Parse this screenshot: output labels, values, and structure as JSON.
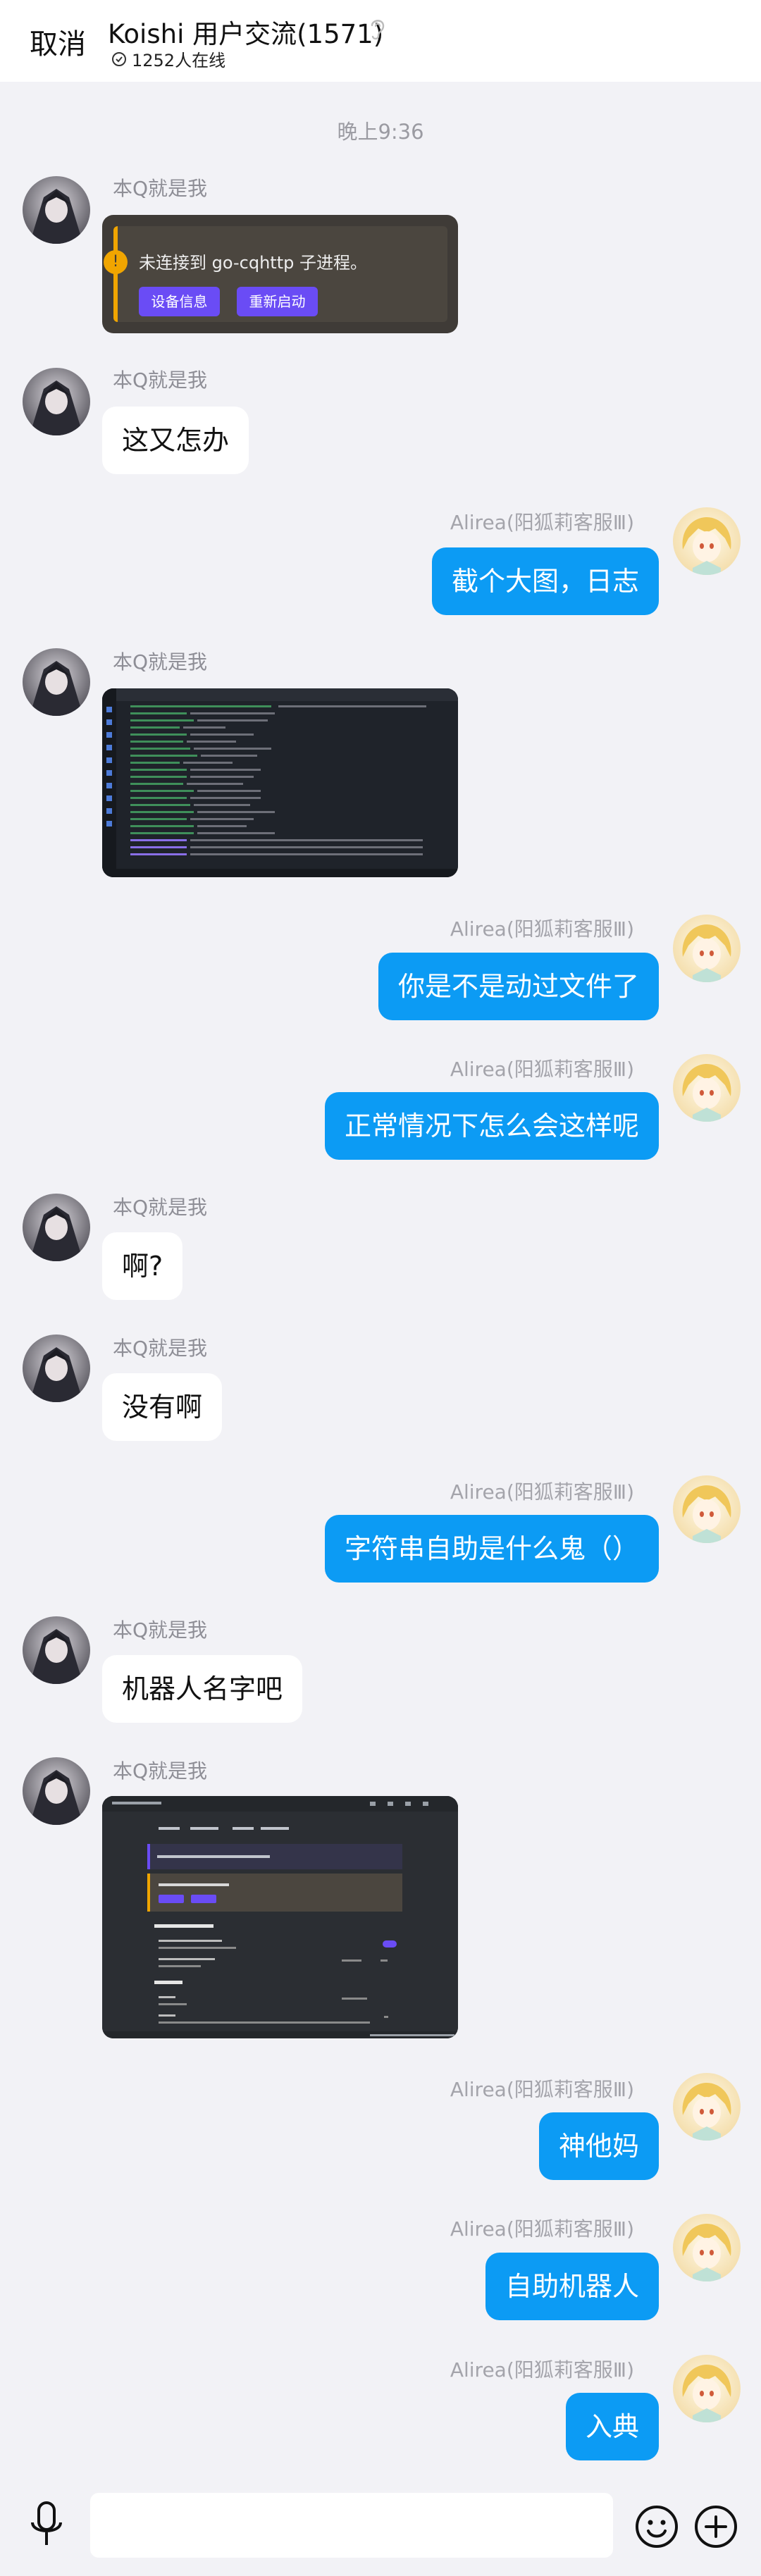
{
  "header": {
    "cancel_label": "取消",
    "title": "Koishi 用户交流(1571)",
    "online_text": "1252人在线"
  },
  "time_separator": "晚上9:36",
  "sender_left": "本Q就是我",
  "sender_right": "Alirea(阳狐莉客服Ⅲ)",
  "messages": {
    "m1": {
      "side": "left",
      "type": "image",
      "alert_text": "未连接到 go-cqhttp 子进程。",
      "btn1": "设备信息",
      "btn2": "重新启动"
    },
    "m2": {
      "side": "left",
      "text": "这又怎办"
    },
    "m3": {
      "side": "right",
      "text": "截个大图，日志"
    },
    "m4": {
      "side": "left",
      "type": "image",
      "description_icon": "terminal-log-screenshot"
    },
    "m5": {
      "side": "right",
      "text": "你是不是动过文件了"
    },
    "m6": {
      "side": "right",
      "text": "正常情况下怎么会这样呢"
    },
    "m7": {
      "side": "left",
      "text": "啊?"
    },
    "m8": {
      "side": "left",
      "text": "没有啊"
    },
    "m9": {
      "side": "right",
      "text": "字符串自助是什么鬼（）"
    },
    "m10": {
      "side": "left",
      "text": "机器人名字吧"
    },
    "m11": {
      "side": "left",
      "type": "image",
      "description_icon": "settings-screenshot"
    },
    "m12": {
      "side": "right",
      "text": "神他妈"
    },
    "m13": {
      "side": "right",
      "text": "自助机器人"
    },
    "m14": {
      "side": "right",
      "text": "入典"
    }
  },
  "colors": {
    "bubble_right": "#0c9bf4",
    "bubble_left": "#ffffff",
    "background": "#f2f2f6"
  },
  "icons": [
    "ear-icon",
    "online-status-icon",
    "microphone-icon",
    "emoji-icon",
    "plus-icon"
  ]
}
